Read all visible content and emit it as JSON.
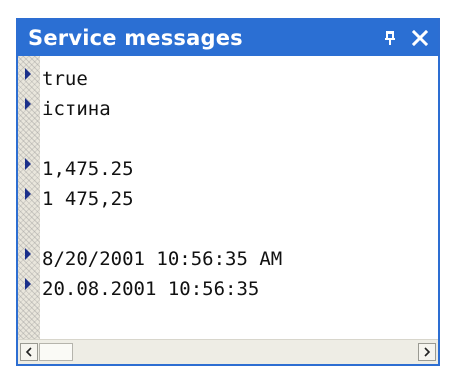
{
  "panel": {
    "title": "Service messages",
    "accent_color": "#2b6fd3",
    "pin_icon": "pin-icon",
    "close_icon": "close-icon"
  },
  "messages": [
    "true",
    "істина",
    "",
    "1,475.25",
    "1 475,25",
    "",
    "8/20/2001 10:56:35 AM",
    "20.08.2001 10:56:35"
  ],
  "scrollbar": {
    "left_icon": "arrow-left-icon",
    "right_icon": "arrow-right-icon",
    "position": 0
  }
}
